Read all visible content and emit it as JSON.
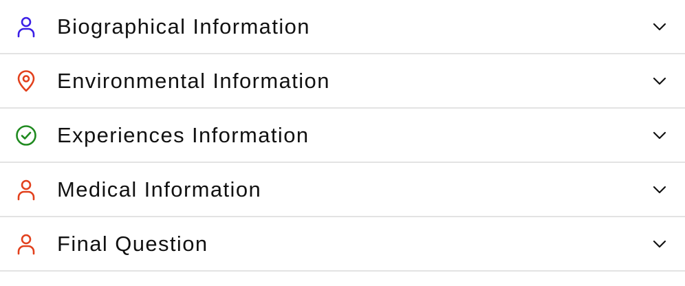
{
  "sections": [
    {
      "label": "Biographical Information",
      "icon": "user-icon",
      "icon_color": "#3a1ee6"
    },
    {
      "label": "Environmental Information",
      "icon": "location-pin-icon",
      "icon_color": "#e2401c"
    },
    {
      "label": "Experiences Information",
      "icon": "check-circle-icon",
      "icon_color": "#1f8a1f"
    },
    {
      "label": "Medical Information",
      "icon": "user-icon",
      "icon_color": "#e2401c"
    },
    {
      "label": "Final Question",
      "icon": "user-icon",
      "icon_color": "#e2401c"
    }
  ],
  "chevron_icon": "chevron-down-icon",
  "colors": {
    "text": "#111111",
    "divider": "#e3e3e3",
    "chevron": "#111111"
  }
}
